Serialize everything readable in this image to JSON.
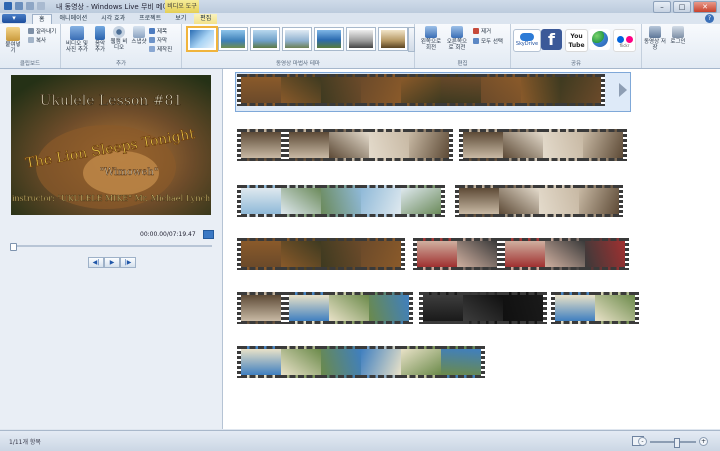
{
  "window": {
    "title": "내 동영상 - Windows Live 무비 메이커",
    "context_tab": "비디오 도구",
    "min": "–",
    "max": "□",
    "close": "✕"
  },
  "tabs": [
    {
      "label": "홈",
      "active": true
    },
    {
      "label": "애니메이션"
    },
    {
      "label": "시각 효과"
    },
    {
      "label": "프로젝트"
    },
    {
      "label": "보기"
    },
    {
      "label": "편집",
      "contextual": true
    }
  ],
  "app_button": "▾",
  "help": "?",
  "ribbon": {
    "clipboard": {
      "label": "클립보드",
      "paste": "붙여넣기",
      "cut": "잘라내기",
      "copy": "복사"
    },
    "add": {
      "label": "추가",
      "add_video": "비디오 및 사진 추가",
      "add_music": "음악 추가",
      "webcam": "웹캠 비디오",
      "snapshot": "스냅샷",
      "title": "제목",
      "caption": "자막",
      "credits": "제작진"
    },
    "themes": {
      "label": "동영상 마법사 테마"
    },
    "edit": {
      "label": "편집",
      "rotate_left": "왼쪽으로 회전",
      "rotate_right": "오른쪽으로 회전",
      "remove": "제거",
      "select_all": "모두 선택"
    },
    "share": {
      "label": "공유",
      "skydrive": "SkyDrive",
      "facebook": "f",
      "youtube": "You Tube",
      "flickr": "flickr",
      "save_movie": "동영상 저장",
      "signin": "로그인"
    }
  },
  "preview": {
    "line1": "Ukulele Lesson #81",
    "line2": "The Lion Sleeps Tonight",
    "line3": "\"Wimoweh\"",
    "line4": "instructor: \"UKULELE MIKE\" Mr. Michael Lynch",
    "timecode": "00:00.00/07:19.47",
    "progress": 0.0
  },
  "controls": {
    "prev": "◀|",
    "play": "▶",
    "next": "|▶"
  },
  "status": {
    "items": "1/11개 항목"
  },
  "colors": {
    "accent": "#1f56a8",
    "ribbon_bg": "#e8eef6"
  }
}
